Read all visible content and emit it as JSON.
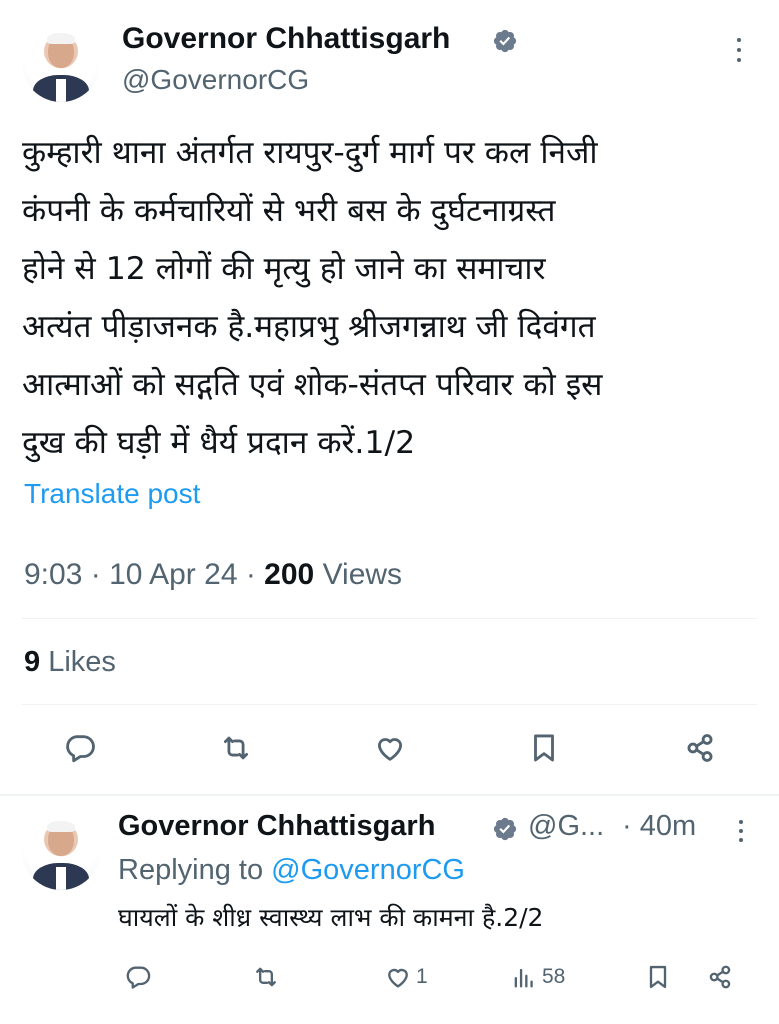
{
  "main_tweet": {
    "display_name": "Governor Chhattisgarh",
    "handle": "@GovernorCG",
    "text_lines": [
      "कुम्हारी थाना अंतर्गत रायपुर-दुर्ग मार्ग पर  कल निजी",
      "कंपनी के कर्मचारियों से भरी बस के दुर्घटनाग्रस्त",
      "होने से 12 लोगों की मृत्यु हो जाने का समाचार",
      "अत्यंत पीड़ाजनक है.महाप्रभु श्रीजगन्नाथ जी दिवंगत",
      "आत्माओं को सद्गति एवं शोक-संतप्त परिवार को इस",
      "दुख की घड़ी में धैर्य प्रदान करें.1/2"
    ],
    "translate_label": "Translate post",
    "time": "9:03",
    "date": "10 Apr 24",
    "views_count": "200",
    "views_label": "Views",
    "likes_count": "9",
    "likes_label": "Likes",
    "actions": [
      "reply-icon",
      "retweet-icon",
      "like-icon",
      "bookmark-icon",
      "share-icon"
    ]
  },
  "reply_tweet": {
    "display_name": "Governor Chhattisgarh",
    "handle": "@G...",
    "time": "· 40m",
    "replying_prefix": "Replying to",
    "replying_to": "@GovernorCG",
    "text": "घायलों के शीध्र स्वास्थ्य लाभ की कामना है.2/2",
    "like_count": "1",
    "views_count": "58",
    "actions": [
      "reply-icon",
      "retweet-icon",
      "like-icon",
      "views-icon",
      "bookmark-icon",
      "share-icon"
    ]
  },
  "colors": {
    "text": "#0f1419",
    "secondary": "#536471",
    "link": "#1d9bf0",
    "divider": "#eff3f4",
    "verified_badge": "#6b7a8c"
  }
}
